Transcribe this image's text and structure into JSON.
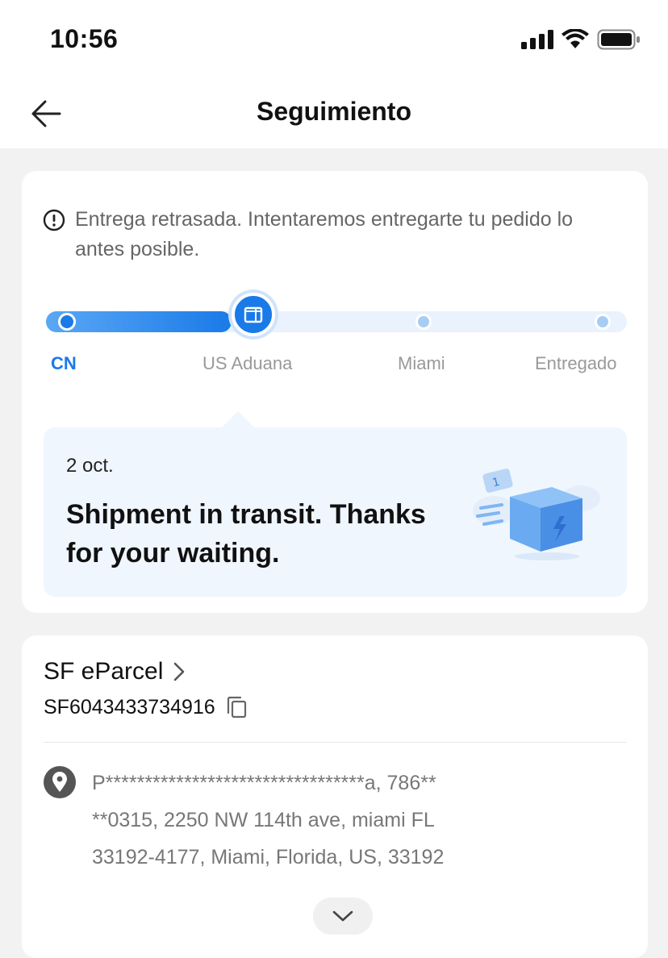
{
  "status_bar": {
    "time": "10:56"
  },
  "header": {
    "title": "Seguimiento"
  },
  "notice": {
    "text": "Entrega retrasada. Intentaremos entregarte tu pedido lo antes posible."
  },
  "progress": {
    "level": 0.32,
    "stages": [
      "CN",
      "US Aduana",
      "Miami",
      "Entregado"
    ],
    "active_stage": "CN",
    "current_stage": "US Aduana"
  },
  "event": {
    "date": "2 oct.",
    "message": "Shipment in transit. Thanks for your waiting."
  },
  "shipment": {
    "carrier": "SF eParcel",
    "tracking_number": "SF6043433734916",
    "address_lines": [
      "P*********************************a,  786**",
      "**0315,  2250 NW 114th ave, miami FL",
      "33192-4177,  Miami,  Florida,  US,  33192"
    ]
  },
  "colors": {
    "accent": "#1a7ae8",
    "accent_light": "#e9f2fd",
    "background": "#f2f2f2",
    "muted_text": "#999999"
  },
  "icons": {
    "back": "back-arrow-icon",
    "notice": "exclamation-circle-icon",
    "chevron": "chevron-right-icon",
    "copy": "copy-icon",
    "location": "location-pin-icon",
    "expand": "chevron-down-icon"
  }
}
